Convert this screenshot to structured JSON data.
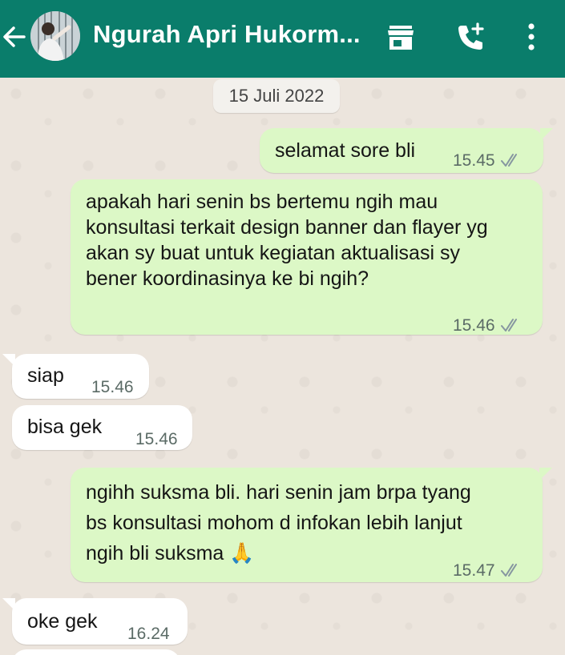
{
  "header": {
    "title": "Ngurah Apri Hukorm...",
    "back_icon": "arrow-back-icon",
    "shop_icon": "storefront-icon",
    "call_icon": "add-call-icon",
    "menu_icon": "more-vert-icon",
    "bg_color": "#0a7d6b"
  },
  "chat": {
    "date": "15 Juli 2022",
    "messages": [
      {
        "dir": "out",
        "text": "selamat sore bli",
        "time": "15.45",
        "status": "read-ticks"
      },
      {
        "dir": "out",
        "text": "apakah hari senin bs bertemu ngih mau konsultasi terkait design banner dan flayer yg akan sy buat untuk kegiatan aktualisasi sy\nbener koordinasinya ke bi ngih?",
        "time": "15.46",
        "status": "read-ticks"
      },
      {
        "dir": "in",
        "text": "siap",
        "time": "15.46"
      },
      {
        "dir": "in",
        "text": "bisa gek",
        "time": "15.46"
      },
      {
        "dir": "out",
        "text": "ngihh suksma bli. hari senin jam brpa tyang bs konsultasi mohom d infokan lebih lanjut ngih bli suksma 🙏",
        "time": "15.47",
        "status": "read-ticks"
      },
      {
        "dir": "in",
        "text": "oke gek",
        "time": "16.24"
      }
    ]
  },
  "colors": {
    "outgoing": "#dcf8c6",
    "incoming": "#ffffff",
    "tick": "#8696a0"
  }
}
